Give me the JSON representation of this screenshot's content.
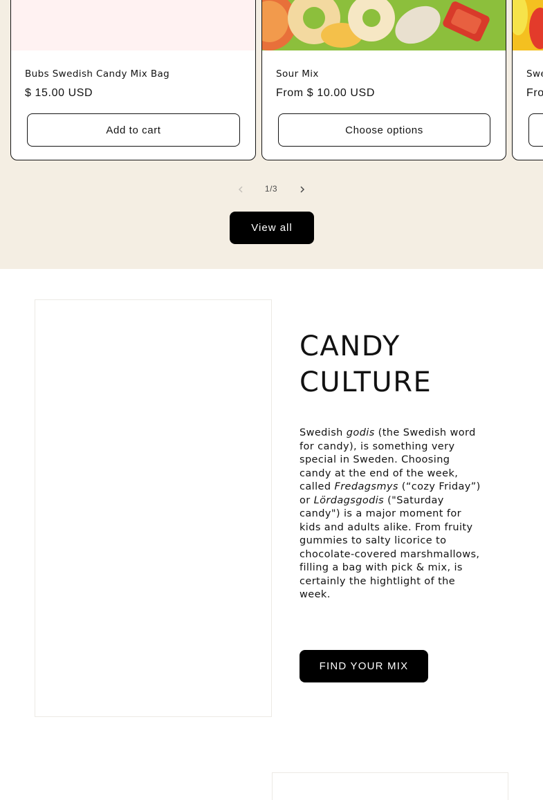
{
  "products": [
    {
      "title": "Bubs Swedish Candy Mix Bag",
      "price": "$ 15.00 USD",
      "button": "Add to cart",
      "image_color": "#fff2f2"
    },
    {
      "title": "Sour Mix",
      "price": "From $ 10.00 USD",
      "button": "Choose options",
      "image_color": "#8bbf3a"
    },
    {
      "title": "Swe",
      "price": "Fro",
      "button": "",
      "image_color": "#f4c020"
    }
  ],
  "pager": {
    "current": "1",
    "separator": "/",
    "total": "3",
    "prev_icon": "chevron-left-icon",
    "next_icon": "chevron-right-icon"
  },
  "view_all_label": "View all",
  "culture": {
    "heading_line1": "CANDY",
    "heading_line2": "CULTURE",
    "body": {
      "t1": "Swedish ",
      "i1": "godis",
      "t2": " (the Swedish word for candy), is something very special in Sweden. Choosing candy at the end of the week, called ",
      "i2": "Fredagsmys",
      "t3": " (“cozy Friday”) or ",
      "i3": "Lördagsgodis",
      "t4": " (\"Saturday candy\") is a major moment for kids and adults alike. From fruity gummies to salty licorice to chocolate-covered marshmallows, filling a bag with pick & mix, is certainly the hightlight of the week."
    },
    "button": "FIND YOUR MIX"
  },
  "colors": {
    "section_bg": "#f4eee3",
    "button_bg": "#000000",
    "text": "#121212"
  }
}
